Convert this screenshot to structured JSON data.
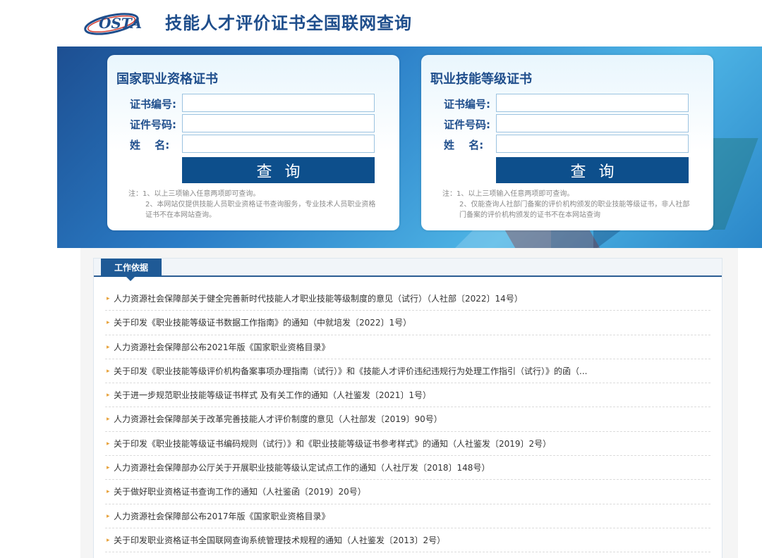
{
  "header": {
    "logo_text": "OSTA",
    "site_title": "技能人才评价证书全国联网查询"
  },
  "cards": [
    {
      "title": "国家职业资格证书",
      "fields": [
        {
          "label": "证书编号:",
          "value": ""
        },
        {
          "label": "证件号码:",
          "value": ""
        },
        {
          "label": "姓　 名:",
          "value": ""
        }
      ],
      "button": "查询",
      "notes": [
        "注：1、以上三项输入任意两项即可查询。",
        "2、本网站仅提供技能人员职业资格证书查询服务，专业技术人员职业资格证书不在本网站查询。"
      ]
    },
    {
      "title": "职业技能等级证书",
      "fields": [
        {
          "label": "证书编号:",
          "value": ""
        },
        {
          "label": "证件号码:",
          "value": ""
        },
        {
          "label": "姓　 名:",
          "value": ""
        }
      ],
      "button": "查询",
      "notes": [
        "注：1、以上三项输入任意两项即可查询。",
        "2、仅能查询人社部门备案的评价机构颁发的职业技能等级证书，非人社部门备案的评价机构颁发的证书不在本网站查询"
      ]
    }
  ],
  "work_basis": {
    "tab_label": "工作依据",
    "items": [
      "人力资源社会保障部关于健全完善新时代技能人才职业技能等级制度的意见（试行）（人社部〔2022〕14号）",
      "关于印发《职业技能等级证书数据工作指南》的通知（中就培发〔2022〕1号）",
      "人力资源社会保障部公布2021年版《国家职业资格目录》",
      "关于印发《职业技能等级评价机构备案事项办理指南（试行）》和《技能人才评价违纪违规行为处理工作指引（试行）》的函（...",
      "关于进一步规范职业技能等级证书样式 及有关工作的通知（人社鉴发〔2021〕1号）",
      "人力资源社会保障部关于改革完善技能人才评价制度的意见（人社部发〔2019〕90号）",
      "关于印发《职业技能等级证书编码规则（试行）》和《职业技能等级证书参考样式》的通知（人社鉴发〔2019〕2号）",
      "人力资源社会保障部办公厅关于开展职业技能等级认定试点工作的通知（人社厅发〔2018〕148号）",
      "关于做好职业资格证书查询工作的通知（人社鉴函〔2019〕20号）",
      "人力资源社会保障部公布2017年版《国家职业资格目录》",
      "关于印发职业资格证书全国联网查询系统管理技术规程的通知（人社鉴发〔2013〕2号）"
    ]
  },
  "colors": {
    "brand_blue": "#1f4e8c",
    "button_blue": "#0d4f8c",
    "bullet_orange": "#e8a33d"
  }
}
